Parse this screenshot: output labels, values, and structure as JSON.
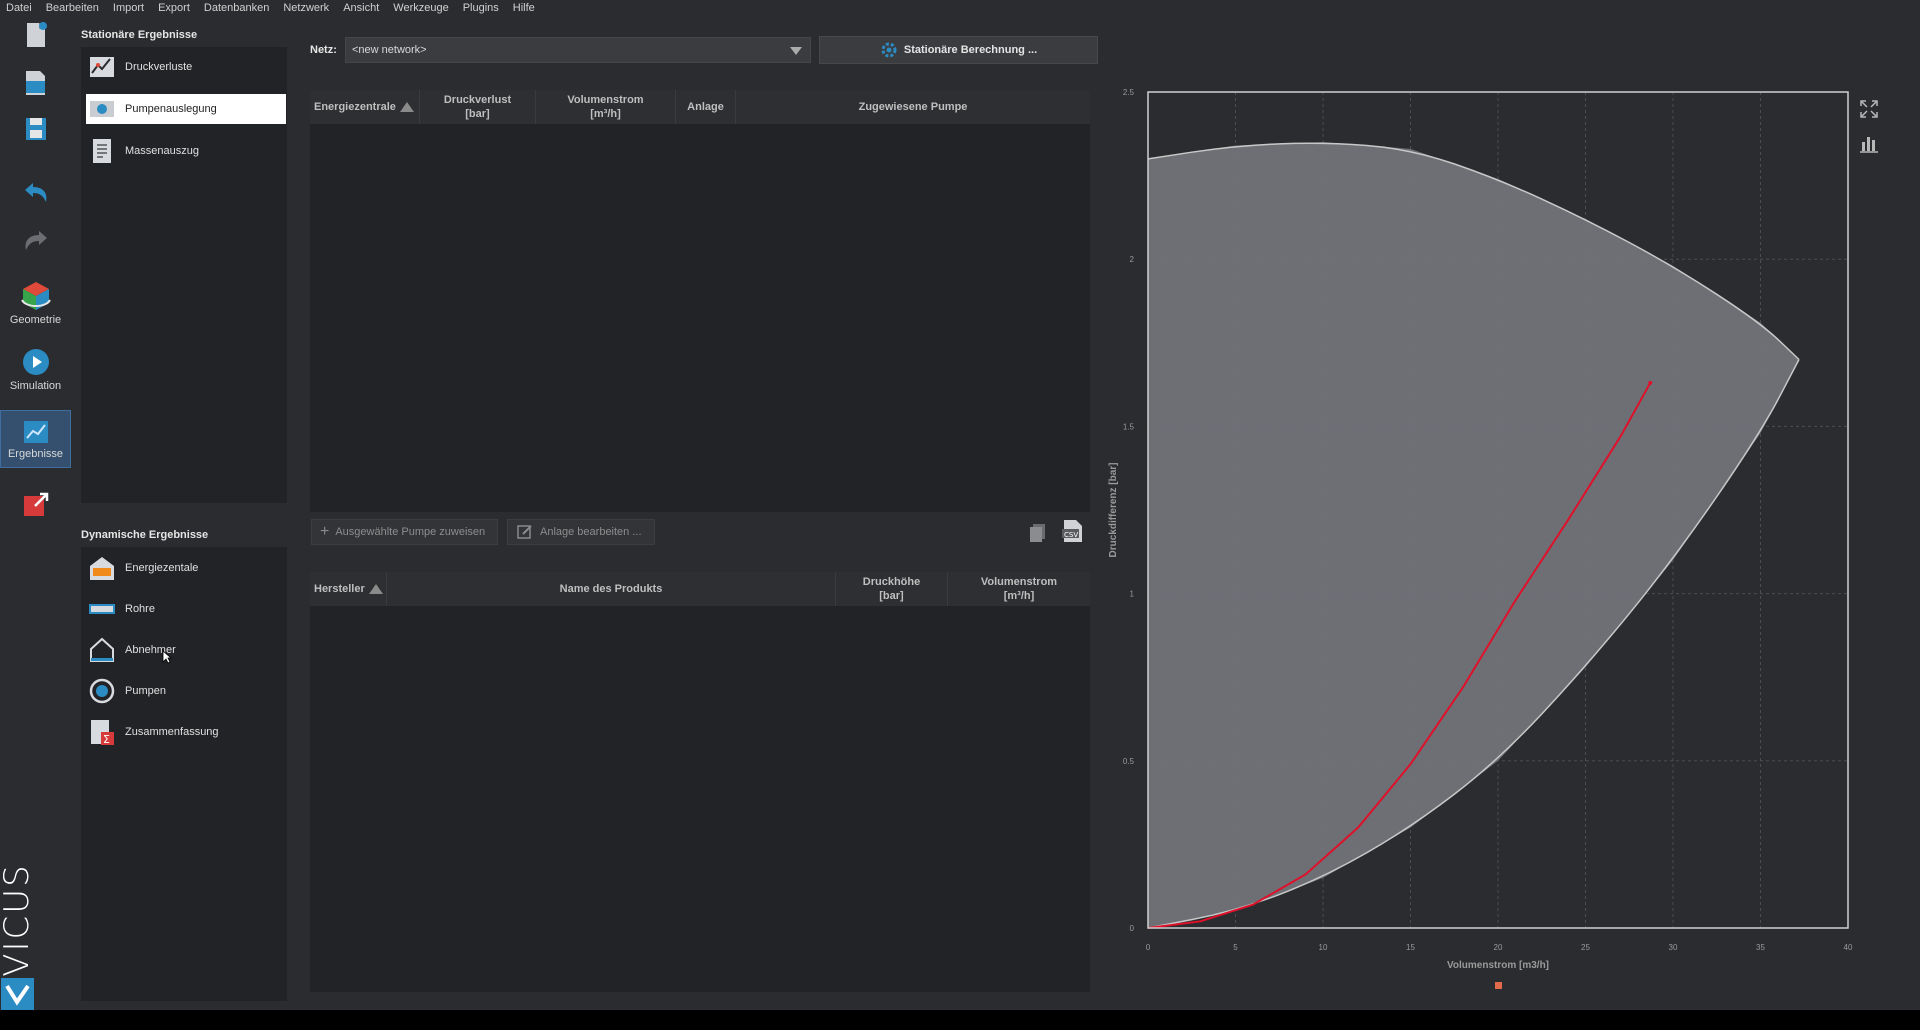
{
  "menu": [
    "Datei",
    "Bearbeiten",
    "Import",
    "Export",
    "Datenbanken",
    "Netzwerk",
    "Ansicht",
    "Werkzeuge",
    "Plugins",
    "Hilfe"
  ],
  "sidebar": {
    "geometry": "Geometrie",
    "simulation": "Simulation",
    "results": "Ergebnisse",
    "brand": "VICUS"
  },
  "stationary": {
    "title": "Stationäre Ergebnisse",
    "items": [
      "Druckverluste",
      "Pumpenauslegung",
      "Massenauszug"
    ],
    "selected": "Pumpenauslegung"
  },
  "dynamic": {
    "title": "Dynamische Ergebnisse",
    "items": [
      "Energiezentale",
      "Rohre",
      "Abnehmer",
      "Pumpen",
      "Zusammenfassung"
    ]
  },
  "network": {
    "label": "Netz:",
    "value": "<new network>",
    "calc_button": "Stationäre Berechnung ..."
  },
  "table1": {
    "headers": {
      "energy": "Energiezentrale",
      "pressure": "Druckverlust",
      "pressure_unit": "[bar]",
      "flow": "Volumenstrom",
      "flow_unit": "[m³/h]",
      "plant": "Anlage",
      "pump": "Zugewiesene Pumpe"
    }
  },
  "actions": {
    "assign": "Ausgewählte Pumpe zuweisen",
    "edit": "Anlage bearbeiten ..."
  },
  "table2": {
    "headers": {
      "manufacturer": "Hersteller",
      "product": "Name des Produkts",
      "head": "Druckhöhe",
      "head_unit": "[bar]",
      "flow": "Volumenstrom",
      "flow_unit": "[m³/h]"
    }
  },
  "chart_data": {
    "type": "line",
    "xlabel": "Volumenstrom [m3/h]",
    "ylabel": "Druckdifferenz [bar]",
    "xlim": [
      0,
      40
    ],
    "ylim": [
      0,
      2.5
    ],
    "xticks": [
      "0",
      "5",
      "10",
      "15",
      "20",
      "25",
      "30",
      "35",
      "40"
    ],
    "yticks": [
      "0",
      "0.5",
      "1",
      "1.5",
      "2",
      "2.5"
    ],
    "grid": true,
    "envelope_upper": {
      "x": [
        0,
        5,
        10,
        15,
        20,
        25,
        30,
        35,
        37.2
      ],
      "y": [
        2.3,
        2.34,
        2.35,
        2.33,
        2.24,
        2.12,
        1.98,
        1.81,
        1.7
      ]
    },
    "envelope_lower": {
      "x": [
        0,
        5,
        10,
        15,
        20,
        25,
        30,
        35,
        37.2
      ],
      "y": [
        0,
        0.05,
        0.15,
        0.3,
        0.5,
        0.78,
        1.1,
        1.48,
        1.7
      ]
    },
    "series": [
      {
        "x": [
          0,
          3,
          6,
          9,
          12,
          15,
          18,
          21,
          24,
          27,
          28.7
        ],
        "y": [
          0,
          0.02,
          0.07,
          0.16,
          0.3,
          0.49,
          0.72,
          0.98,
          1.22,
          1.47,
          1.63
        ]
      }
    ],
    "colors": {
      "envelope": "#717379",
      "curve": "#e0102a",
      "background": "#2b2c2f",
      "grid": "#4b4d52"
    }
  }
}
